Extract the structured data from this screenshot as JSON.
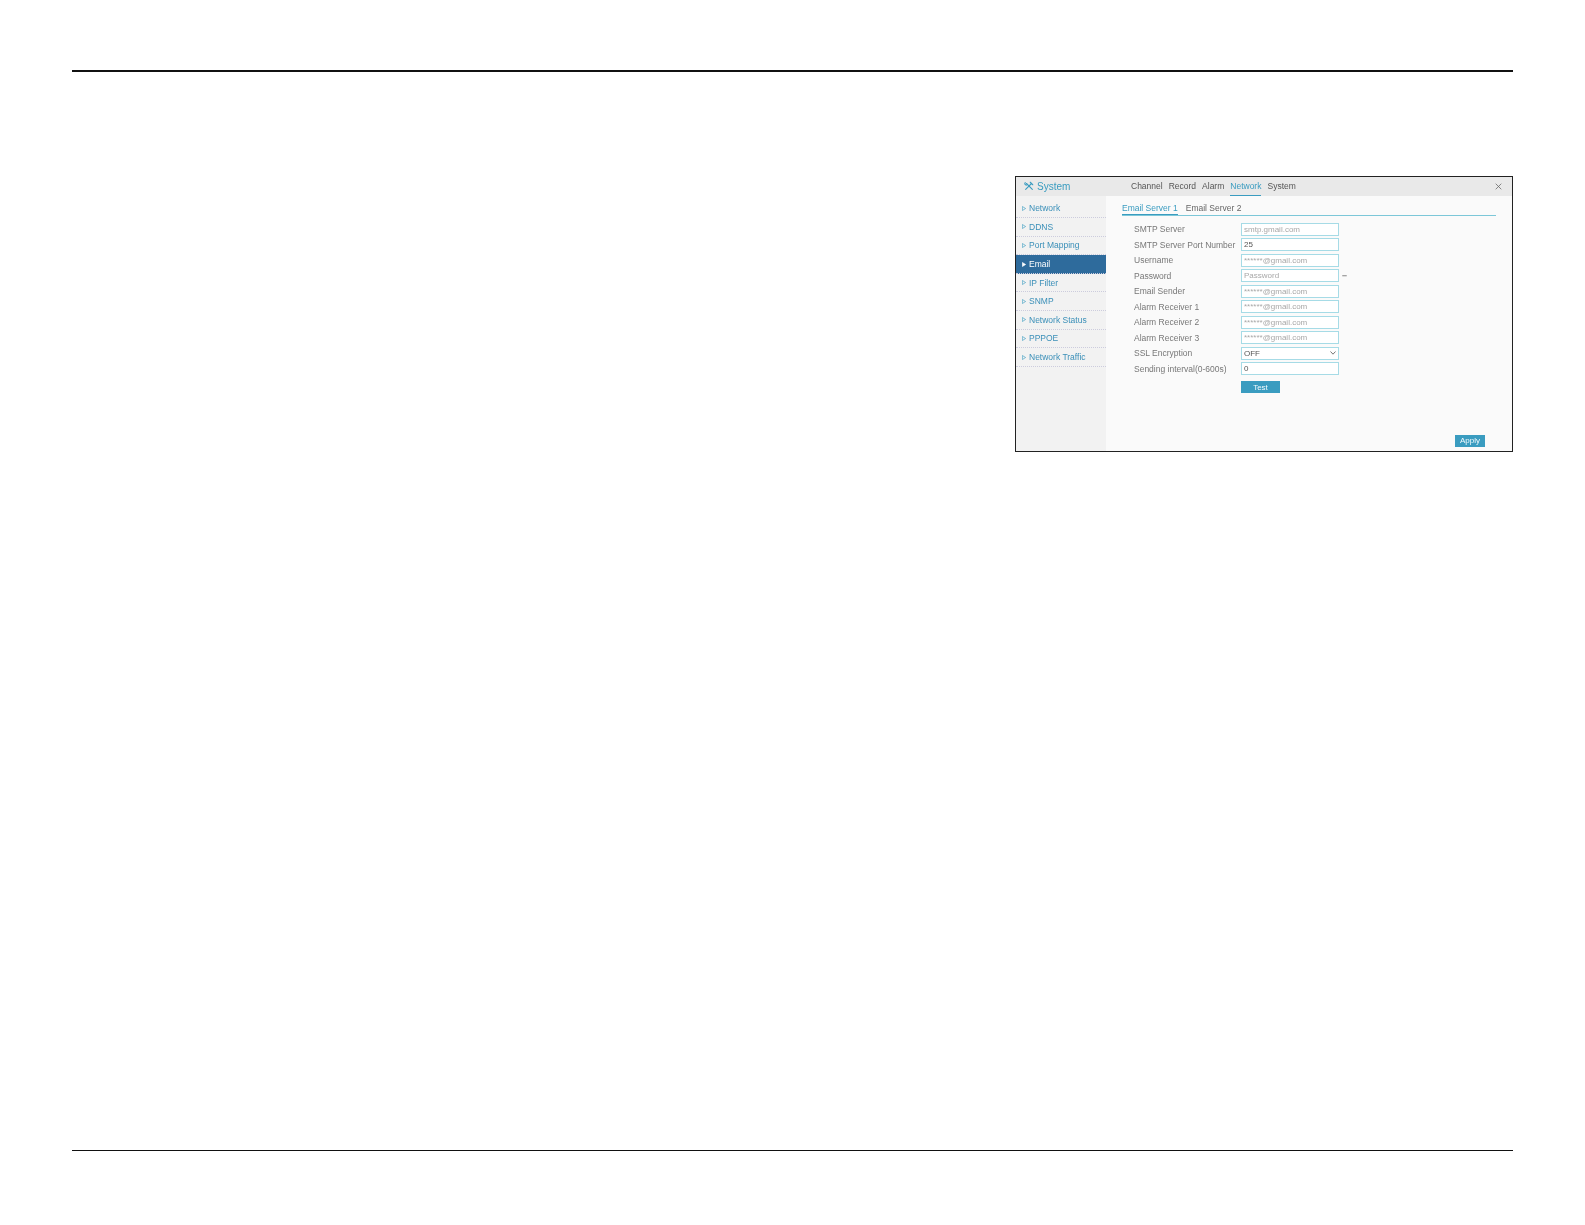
{
  "window": {
    "title": "System"
  },
  "tabs": [
    {
      "label": "Channel",
      "selected": false
    },
    {
      "label": "Record",
      "selected": false
    },
    {
      "label": "Alarm",
      "selected": false
    },
    {
      "label": "Network",
      "selected": true
    },
    {
      "label": "System",
      "selected": false
    }
  ],
  "sidebar": {
    "items": [
      {
        "label": "Network",
        "selected": false
      },
      {
        "label": "DDNS",
        "selected": false
      },
      {
        "label": "Port Mapping",
        "selected": false
      },
      {
        "label": "Email",
        "selected": true
      },
      {
        "label": "IP Filter",
        "selected": false
      },
      {
        "label": "SNMP",
        "selected": false
      },
      {
        "label": "Network Status",
        "selected": false
      },
      {
        "label": "PPPOE",
        "selected": false
      },
      {
        "label": "Network Traffic",
        "selected": false
      }
    ]
  },
  "subtabs": [
    {
      "label": "Email Server 1",
      "selected": true
    },
    {
      "label": "Email Server 2",
      "selected": false
    }
  ],
  "form": {
    "fields": [
      {
        "label": "SMTP Server",
        "kind": "text",
        "placeholder": "smtp.gmail.com"
      },
      {
        "label": "SMTP Server Port Number",
        "kind": "text",
        "value": "25"
      },
      {
        "label": "Username",
        "kind": "text",
        "placeholder": "******@gmail.com"
      },
      {
        "label": "Password",
        "kind": "password",
        "placeholder": "Password"
      },
      {
        "label": "Email Sender",
        "kind": "text",
        "placeholder": "******@gmail.com"
      },
      {
        "label": "Alarm Receiver 1",
        "kind": "text",
        "placeholder": "******@gmail.com"
      },
      {
        "label": "Alarm Receiver 2",
        "kind": "text",
        "placeholder": "******@gmail.com"
      },
      {
        "label": "Alarm Receiver 3",
        "kind": "text",
        "placeholder": "******@gmail.com"
      },
      {
        "label": "SSL Encryption",
        "kind": "select",
        "value": "OFF"
      },
      {
        "label": "Sending interval(0-600s)",
        "kind": "text",
        "value": "0"
      }
    ],
    "test_button": "Test"
  },
  "apply_button": "Apply"
}
